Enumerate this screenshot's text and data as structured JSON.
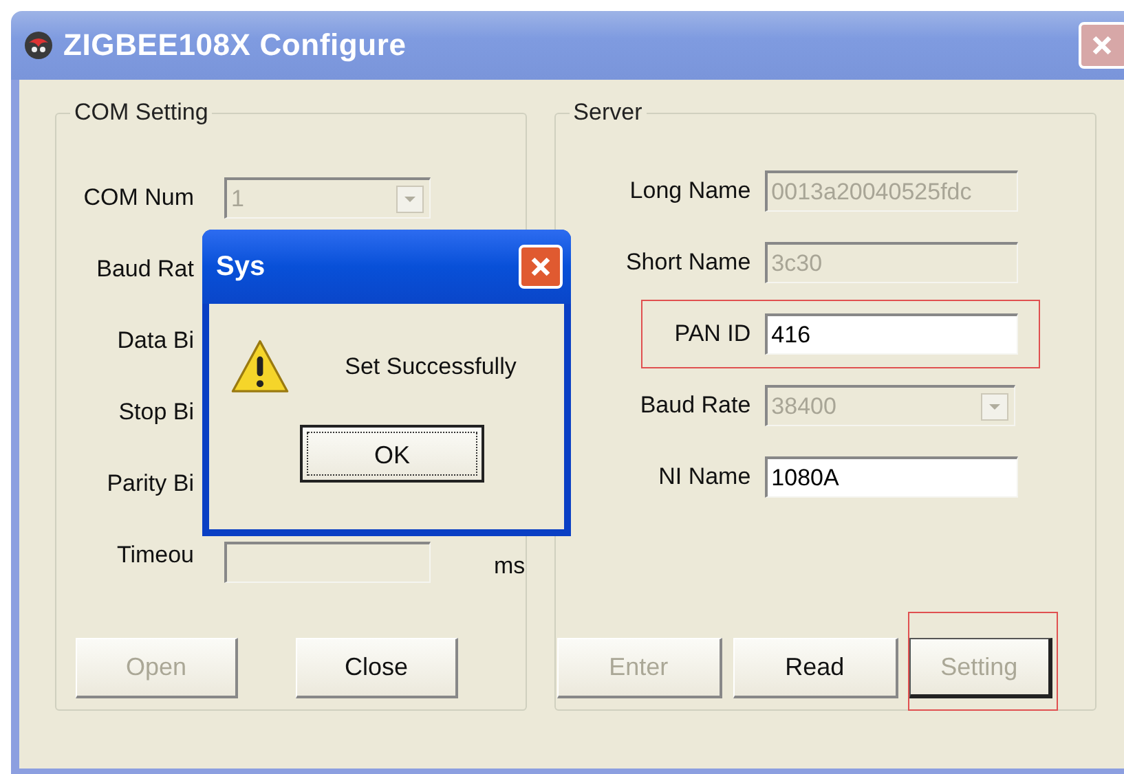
{
  "window": {
    "title": "ZIGBEE108X  Configure"
  },
  "com_setting": {
    "title": "COM Setting",
    "fields": [
      {
        "label": "COM Num",
        "kind": "combo",
        "value": "1",
        "disabled": true
      },
      {
        "label": "Baud Rat",
        "kind": "covered"
      },
      {
        "label": "Data Bi",
        "kind": "covered"
      },
      {
        "label": "Stop Bi",
        "kind": "covered"
      },
      {
        "label": "Parity Bi",
        "kind": "covered"
      },
      {
        "label": "Timeou",
        "kind": "text",
        "disabled": true,
        "unit": "ms"
      }
    ],
    "buttons": [
      {
        "label": "Open",
        "disabled": true,
        "highlighted": false,
        "default": false
      },
      {
        "label": "Close",
        "disabled": false,
        "highlighted": false,
        "default": false
      }
    ]
  },
  "server": {
    "title": "Server",
    "fields": [
      {
        "label": "Long Name",
        "kind": "text",
        "value": "0013a20040525fdc",
        "disabled": true,
        "highlighted": false
      },
      {
        "label": "Short Name",
        "kind": "text",
        "value": "3c30",
        "disabled": true,
        "highlighted": false
      },
      {
        "label": "PAN ID",
        "kind": "text",
        "value": "416",
        "disabled": false,
        "highlighted": true
      },
      {
        "label": "Baud Rate",
        "kind": "combo",
        "value": "38400",
        "disabled": true,
        "highlighted": false
      },
      {
        "label": "NI Name",
        "kind": "text",
        "value": "1080A",
        "disabled": false,
        "highlighted": false
      }
    ],
    "buttons": [
      {
        "label": "Enter",
        "disabled": true,
        "highlighted": false,
        "default": false
      },
      {
        "label": "Read",
        "disabled": false,
        "highlighted": false,
        "default": false
      },
      {
        "label": "Setting",
        "disabled": true,
        "highlighted": true,
        "default": true
      }
    ]
  },
  "dialog": {
    "title": "Sys",
    "message": "Set Successfully",
    "button": {
      "label": "OK",
      "focused": true
    }
  }
}
